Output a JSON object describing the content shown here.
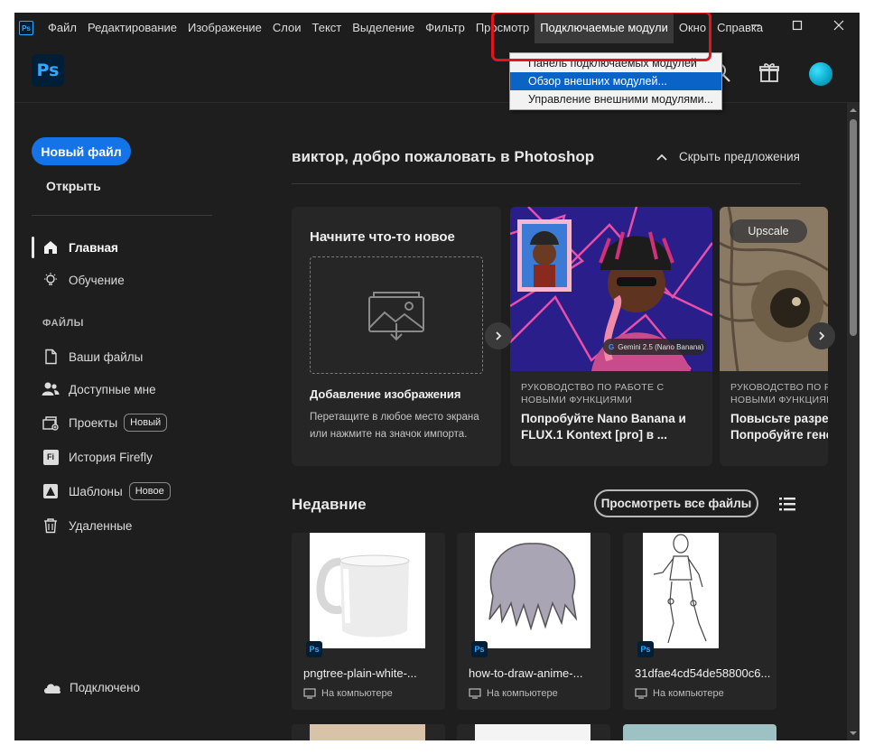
{
  "app": {
    "name": "Photoshop",
    "logo_text": "Ps"
  },
  "menubar": {
    "items": [
      "Файл",
      "Редактирование",
      "Изображение",
      "Слои",
      "Текст",
      "Выделение",
      "Фильтр",
      "Просмотр",
      "Подключаемые модули",
      "Окно",
      "Справка"
    ],
    "open_item": "Подключаемые модули",
    "window_controls": {
      "minimize": "—",
      "maximize": "☐",
      "close": "✕"
    }
  },
  "dropdown": {
    "items": [
      "Панель подключаемых модулей",
      "Обзор внешних модулей...",
      "Управление внешними модулями..."
    ],
    "highlighted_index": 1
  },
  "sidebar": {
    "new_file": "Новый файл",
    "open": "Открыть",
    "nav": [
      {
        "label": "Главная",
        "icon": "home-icon",
        "active": true
      },
      {
        "label": "Обучение",
        "icon": "lightbulb-icon"
      }
    ],
    "files_section": "ФАЙЛЫ",
    "files": [
      {
        "label": "Ваши файлы",
        "icon": "file-icon"
      },
      {
        "label": "Доступные мне",
        "icon": "shared-users-icon"
      },
      {
        "label": "Проекты",
        "icon": "projects-icon",
        "badge": "Новый"
      },
      {
        "label": "История Firefly",
        "icon": "firefly-icon",
        "icon_text": "Fi"
      },
      {
        "label": "Шаблоны",
        "icon": "templates-icon",
        "badge": "Новое"
      },
      {
        "label": "Удаленные",
        "icon": "trash-icon"
      }
    ],
    "status": "Подключено"
  },
  "main": {
    "welcome": "виктор, добро пожаловать в Photoshop",
    "hide_suggestions": "Скрыть предложения",
    "start_card": {
      "title": "Начните что-то новое",
      "subtitle": "Добавление изображения",
      "description": "Перетащите в любое место экрана или нажмите на значок импорта."
    },
    "promo_cards": [
      {
        "kicker": "РУКОВОДСТВО ПО РАБОТЕ С НОВЫМИ ФУНКЦИЯМИ",
        "headline": "Попробуйте Nano Banana и FLUX.1 Kontext [pro] в ...",
        "pill": "Gemini 2.5 (Nano Banana)"
      },
      {
        "kicker": "РУКОВОДСТВО ПО РАБОТЕ С НОВЫМИ ФУНКЦИЯМИ",
        "headline": "Повысьте разрешение. Попробуйте генеративное...",
        "pill": "Upscale"
      }
    ],
    "recent_title": "Недавние",
    "view_all": "Просмотреть все файлы",
    "recent_files": [
      {
        "name": "pngtree-plain-white-...",
        "location": "На компьютере",
        "badge": "Ps"
      },
      {
        "name": "how-to-draw-anime-...",
        "location": "На компьютере",
        "badge": "Ps"
      },
      {
        "name": "31dfae4cd54de58800c6...",
        "location": "На компьютере",
        "badge": "Ps"
      }
    ]
  },
  "colors": {
    "accent": "#1473e6",
    "highlight_box": "#e3141c",
    "menu_selection": "#0a64c8",
    "background": "#1e1e1e"
  }
}
